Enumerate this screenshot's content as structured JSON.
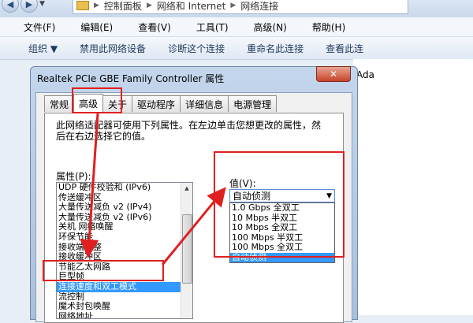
{
  "explorer": {
    "breadcrumb": [
      "控制面板",
      "网络和 Internet",
      "网络连接"
    ],
    "menu": [
      "文件(F)",
      "编辑(E)",
      "查看(V)",
      "工具(T)",
      "高级(N)",
      "帮助(H)"
    ],
    "commands": [
      "组织 ▼",
      "禁用此网络设备",
      "诊断这个连接",
      "重命名此连接",
      "查看此连"
    ],
    "right_partial": "Ada"
  },
  "dialog": {
    "title": "Realtek PCIe GBE Family Controller 属性",
    "close_label": "✕",
    "tabs": [
      "常规",
      "高级",
      "关于",
      "驱动程序",
      "详细信息",
      "电源管理"
    ],
    "active_tab": "高级",
    "description": "此网络适配器可使用下列属性。在左边单击您想更改的属性，然后在右边选择它的值。",
    "property_label": "属性(P):",
    "properties": [
      "UDP 硬件校验和 (IPv6)",
      "传送缓冲区",
      "大量传送减负 v2 (IPv4)",
      "大量传送减负 v2 (IPv6)",
      "关机 网络唤醒",
      "环保节能",
      "接收端调整",
      "接收缓冲区",
      "节能乙太网路",
      "巨型帧",
      "连接速度和双工模式",
      "流控制",
      "魔术封包唤醒",
      "网络地址"
    ],
    "selected_property": "连接速度和双工模式",
    "value_label": "值(V):",
    "value_selected": "自动侦测",
    "value_options": [
      "1.0 Gbps 全双工",
      "10 Mbps 半双工",
      "10 Mbps 全双工",
      "100 Mbps 半双工",
      "100 Mbps 全双工",
      "自动侦测"
    ]
  },
  "colors": {
    "annotation": "#e02020",
    "selection": "#3399ff"
  }
}
